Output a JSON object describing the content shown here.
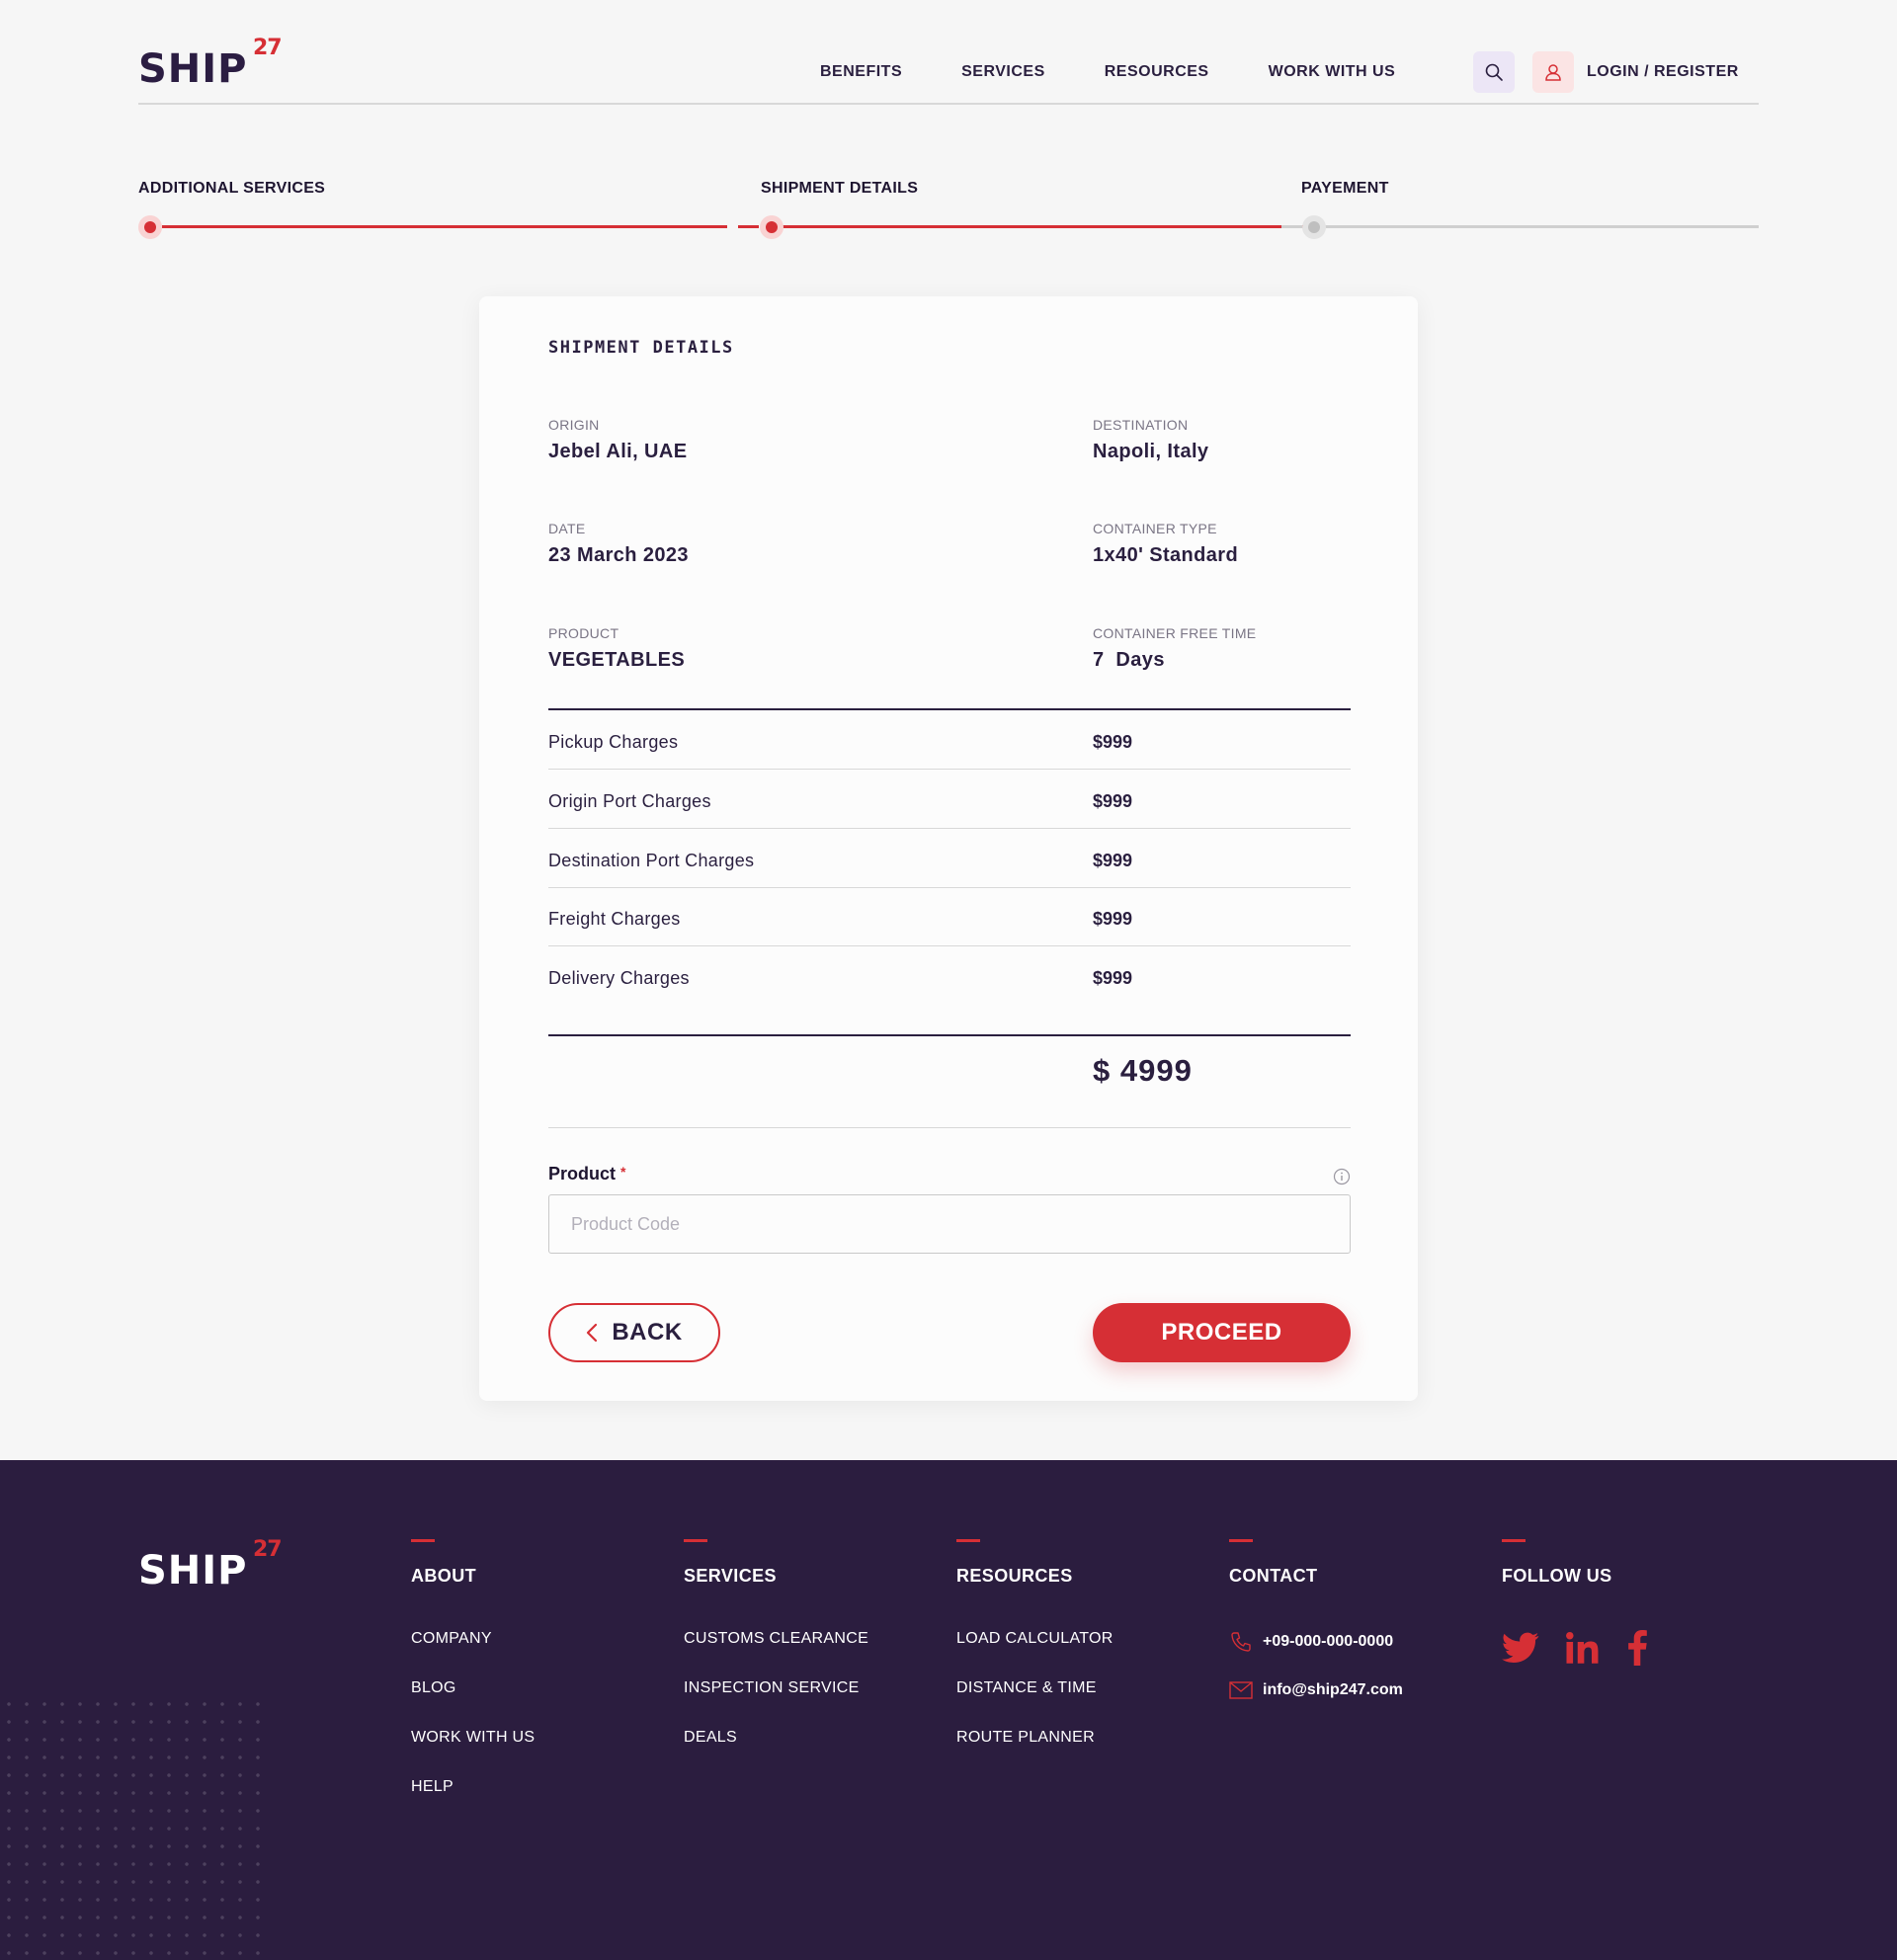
{
  "brand": {
    "name": "SHIP",
    "superscript": "27"
  },
  "nav": {
    "items": [
      "BENEFITS",
      "SERVICES",
      "RESOURCES",
      "WORK WITH US"
    ],
    "login": "LOGIN / REGISTER"
  },
  "stepper": {
    "steps": [
      {
        "label": "ADDITIONAL SERVICES",
        "status": "complete"
      },
      {
        "label": "SHIPMENT DETAILS",
        "status": "active"
      },
      {
        "label": "PAYEMENT",
        "status": "pending"
      }
    ]
  },
  "shipment": {
    "title": "SHIPMENT DETAILS",
    "origin": {
      "label": "ORIGIN",
      "value": "Jebel Ali, UAE"
    },
    "destination": {
      "label": "DESTINATION",
      "value": "Napoli, Italy"
    },
    "date": {
      "label": "DATE",
      "value": "23 March 2023"
    },
    "container_type": {
      "label": "CONTAINER TYPE",
      "value": "1x40' Standard"
    },
    "product": {
      "label": "PRODUCT",
      "value": "VEGETABLES"
    },
    "free_time": {
      "label": "CONTAINER FREE TIME",
      "value": "7  Days"
    },
    "charges": [
      {
        "name": "Pickup Charges",
        "amount": "$999"
      },
      {
        "name": "Origin Port Charges",
        "amount": "$999"
      },
      {
        "name": "Destination Port Charges",
        "amount": "$999"
      },
      {
        "name": "Freight Charges",
        "amount": "$999"
      },
      {
        "name": "Delivery Charges",
        "amount": "$999"
      }
    ],
    "total": "$ 4999"
  },
  "form": {
    "product_label": "Product",
    "required_mark": "*",
    "product_placeholder": "Product Code",
    "product_value": ""
  },
  "actions": {
    "back": "BACK",
    "proceed": "PROCEED"
  },
  "footer": {
    "columns": [
      {
        "title": "ABOUT",
        "links": [
          "COMPANY",
          "BLOG",
          "WORK WITH US",
          "HELP"
        ]
      },
      {
        "title": "SERVICES",
        "links": [
          "CUSTOMS CLEARANCE",
          "INSPECTION SERVICE",
          "DEALS"
        ]
      },
      {
        "title": "RESOURCES",
        "links": [
          "LOAD CALCULATOR",
          "DISTANCE & TIME",
          "ROUTE PLANNER"
        ]
      }
    ],
    "contact": {
      "title": "CONTACT",
      "phone": "+09-000-000-0000",
      "email": "info@ship247.com"
    },
    "follow": {
      "title": "FOLLOW US",
      "icons": [
        "twitter-icon",
        "linkedin-icon",
        "facebook-icon"
      ]
    }
  },
  "colors": {
    "accent": "#d62f35",
    "primary": "#2b1d3f",
    "background": "#f6f6f6"
  }
}
